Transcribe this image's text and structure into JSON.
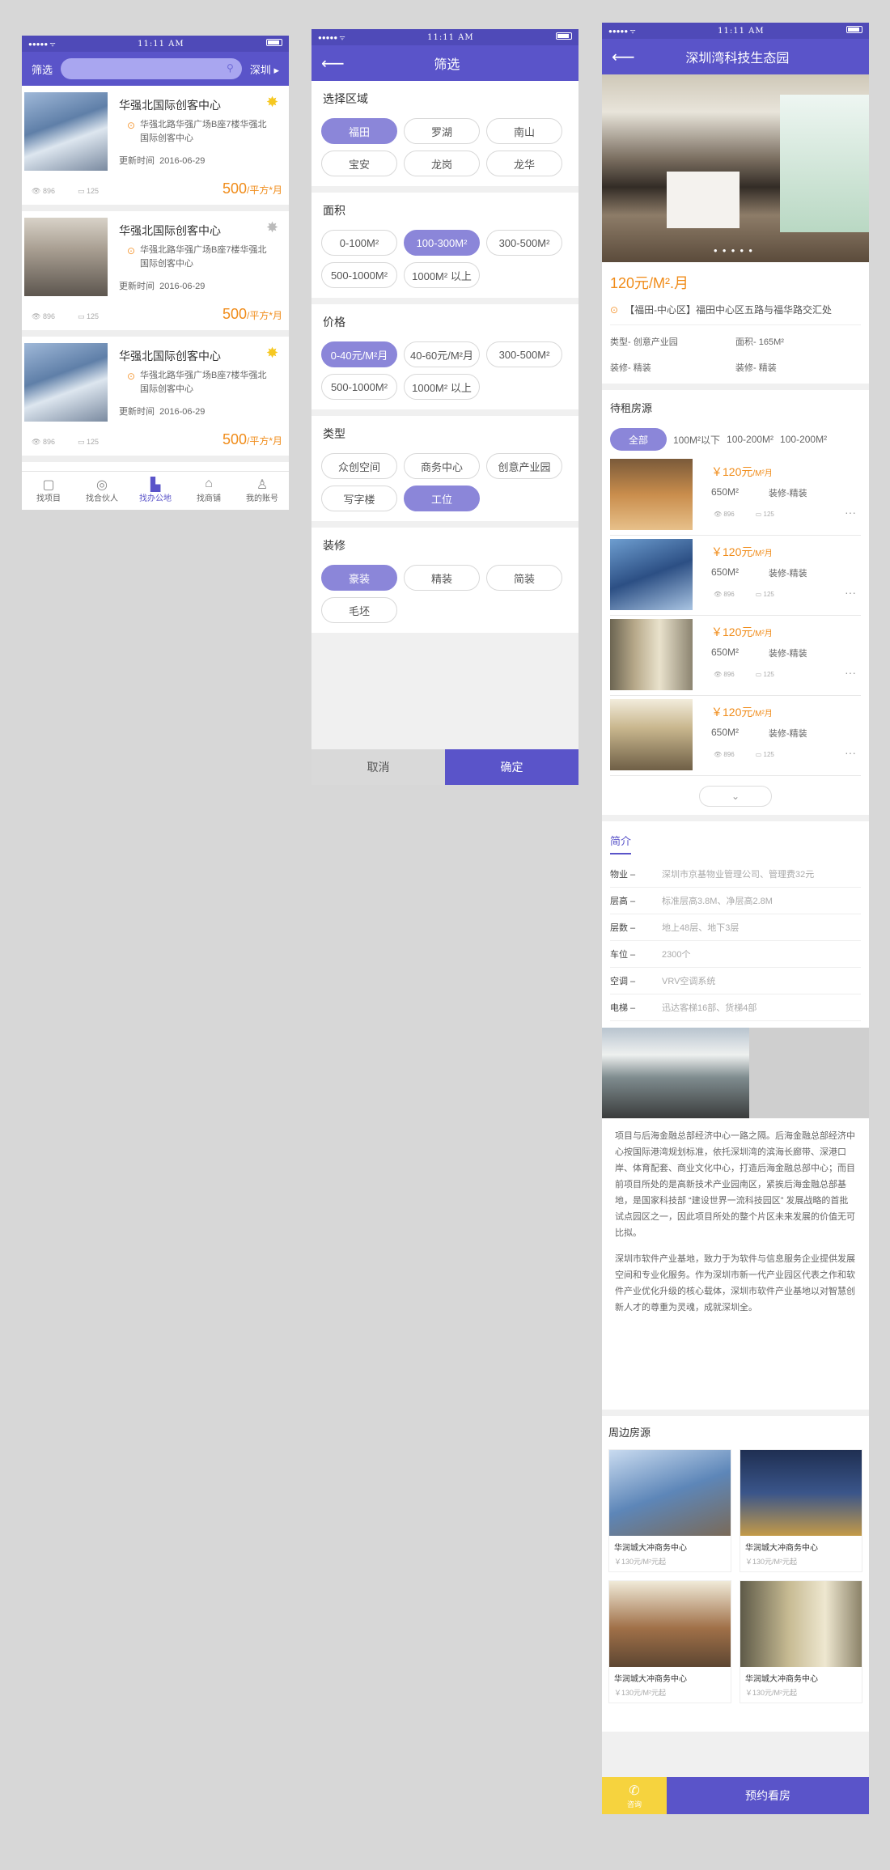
{
  "status": {
    "time": "11:11 AM",
    "dots": "●●●●●"
  },
  "screen1": {
    "filter_label": "筛选",
    "city": "深圳",
    "listings": [
      {
        "title": "华强北国际创客中心",
        "address": "华强北路华强广场B座7楼华强北国际创客中心",
        "date_label": "更新时间",
        "date": "2016-06-29",
        "views": "896",
        "comments": "125",
        "price": "500",
        "unit": "/平方*月",
        "favorited": true
      },
      {
        "title": "华强北国际创客中心",
        "address": "华强北路华强广场B座7楼华强北国际创客中心",
        "date_label": "更新时间",
        "date": "2016-06-29",
        "views": "896",
        "comments": "125",
        "price": "500",
        "unit": "/平方*月",
        "favorited": false
      },
      {
        "title": "华强北国际创客中心",
        "address": "华强北路华强广场B座7楼华强北国际创客中心",
        "date_label": "更新时间",
        "date": "2016-06-29",
        "views": "896",
        "comments": "125",
        "price": "500",
        "unit": "/平方*月",
        "favorited": true
      }
    ],
    "tabs": [
      "找项目",
      "找合伙人",
      "找办公地",
      "找商铺",
      "我的账号"
    ],
    "active_tab": "找办公地"
  },
  "screen2": {
    "title": "筛选",
    "region": {
      "title": "选择区域",
      "options": [
        "福田",
        "罗湖",
        "南山",
        "宝安",
        "龙岗",
        "龙华"
      ],
      "selected": "福田"
    },
    "area": {
      "title": "面积",
      "options": [
        "0-100M²",
        "100-300M²",
        "300-500M²",
        "500-1000M²",
        "1000M² 以上"
      ],
      "selected": "100-300M²"
    },
    "price": {
      "title": "价格",
      "options": [
        "0-40元/M²月",
        "40-60元/M²月",
        "300-500M²",
        "500-1000M²",
        "1000M² 以上"
      ],
      "selected": "0-40元/M²月"
    },
    "type": {
      "title": "类型",
      "options": [
        "众创空间",
        "商务中心",
        "创意产业园",
        "写字楼",
        "工位"
      ],
      "selected": "工位"
    },
    "decoration": {
      "title": "装修",
      "options": [
        "豪装",
        "精装",
        "简装",
        "毛坯"
      ],
      "selected": "豪装"
    },
    "cancel": "取消",
    "confirm": "确定"
  },
  "screen3": {
    "title": "深圳湾科技生态园",
    "price": "120元/M².月",
    "location": "【福田-中心区】福田中心区五路与福华路交汇处",
    "type": "类型- 创意产业园",
    "area": "面积- 165M²",
    "decoration1": "装修- 精装",
    "decoration2": "装修- 精装",
    "rooms_title": "待租房源",
    "room_filters": [
      "全部",
      "100M²以下",
      "100-200M²",
      "100-200M²"
    ],
    "rooms": [
      {
        "price": "￥120元",
        "unit": "/M²月",
        "area": "650M²",
        "deco": "装修-精装",
        "views": "896",
        "comments": "125"
      },
      {
        "price": "￥120元",
        "unit": "/M²月",
        "area": "650M²",
        "deco": "装修-精装",
        "views": "896",
        "comments": "125"
      },
      {
        "price": "￥120元",
        "unit": "/M²月",
        "area": "650M²",
        "deco": "装修-精装",
        "views": "896",
        "comments": "125"
      },
      {
        "price": "￥120元",
        "unit": "/M²月",
        "area": "650M²",
        "deco": "装修-精装",
        "views": "896",
        "comments": "125"
      }
    ],
    "intro_title": "简介",
    "intro_rows": [
      {
        "k": "物业 –",
        "v": "深圳市京基物业管理公司、管理费32元"
      },
      {
        "k": "层高 –",
        "v": "标准层高3.8M、净层高2.8M"
      },
      {
        "k": "层数 –",
        "v": "地上48层、地下3层"
      },
      {
        "k": "车位 –",
        "v": "2300个"
      },
      {
        "k": "空调 –",
        "v": "VRV空调系统"
      },
      {
        "k": "电梯 –",
        "v": "迅达客梯16部、货梯4部"
      }
    ],
    "desc1": "项目与后海金融总部经济中心一路之隔。后海金融总部经济中心按国际港湾规划标准，依托深圳湾的滨海长廊带、深港口岸、体育配套、商业文化中心，打造后海金融总部中心；而目前项目所处的是高新技术产业园南区，紧挨后海金融总部基地，是国家科技部 “建设世界一流科技园区” 发展战略的首批试点园区之一，因此项目所处的整个片区未来发展的价值无可比拟。",
    "desc2": "深圳市软件产业基地，致力于为软件与信息服务企业提供发展空间和专业化服务。作为深圳市新一代产业园区代表之作和软件产业优化升级的核心载体，深圳市软件产业基地以对智慧创新人才的尊重为灵魂，成就深圳全。",
    "nearby_title": "周边房源",
    "nearby": [
      {
        "name": "华润城大冲商务中心",
        "price": "￥130元/M²元起"
      },
      {
        "name": "华润城大冲商务中心",
        "price": "￥130元/M²元起"
      },
      {
        "name": "华润城大冲商务中心",
        "price": "￥130元/M²元起"
      },
      {
        "name": "华润城大冲商务中心",
        "price": "￥130元/M²元起"
      }
    ],
    "call_label": "咨询",
    "book_label": "预约看房"
  },
  "colors": {
    "primary": "#5a54c9",
    "chip_selected": "#8b86d9",
    "price": "#f08c1a",
    "star": "#f6c821",
    "call": "#f6d33e"
  }
}
